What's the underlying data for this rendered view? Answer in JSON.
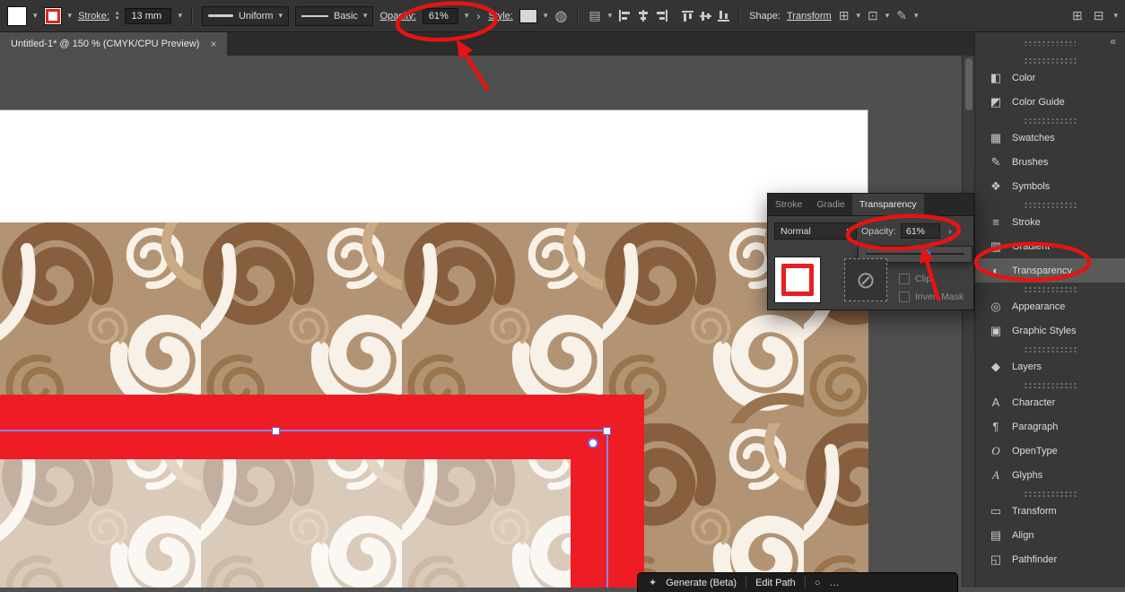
{
  "toolbar": {
    "stroke_label": "Stroke:",
    "stroke_value": "13 mm",
    "width_profile": "Uniform",
    "brush_name": "Basic",
    "opacity_label": "Opacity:",
    "opacity_value": "61%",
    "style_label": "Style:",
    "shape_label": "Shape:",
    "transform_label": "Transform"
  },
  "tabbar": {
    "document_title": "Untitled-1* @ 150 % (CMYK/CPU Preview)",
    "close_glyph": "×"
  },
  "panel": {
    "tabs": [
      {
        "label": "Stroke",
        "name": "stroke"
      },
      {
        "label": "Gradie",
        "name": "gradient"
      },
      {
        "label": "Transparency",
        "name": "transparency",
        "active": true
      }
    ],
    "overflow_glyph": "»",
    "menu_glyph": "≡",
    "blend_mode": "Normal",
    "opacity_label": "Opacity:",
    "opacity_value": "61%",
    "mask_glyph": "⊘",
    "clip_label": "Clip",
    "invert_label": "Invert Mask"
  },
  "sidebar": {
    "collapse_glyph": "«",
    "items": [
      {
        "label": "Color",
        "icon": "◧",
        "name": "color",
        "group_start": true
      },
      {
        "label": "Color Guide",
        "icon": "◩",
        "name": "color-guide"
      },
      {
        "label": "Swatches",
        "icon": "▦",
        "name": "swatches",
        "group_start": true
      },
      {
        "label": "Brushes",
        "icon": "✎",
        "name": "brushes"
      },
      {
        "label": "Symbols",
        "icon": "❖",
        "name": "symbols"
      },
      {
        "label": "Stroke",
        "icon": "≡",
        "name": "stroke",
        "group_start": true
      },
      {
        "label": "Gradient",
        "icon": "▥",
        "name": "gradient"
      },
      {
        "label": "Transparency",
        "icon": "◐",
        "name": "transparency",
        "active": true
      },
      {
        "label": "Appearance",
        "icon": "◎",
        "name": "appearance",
        "group_start": true
      },
      {
        "label": "Graphic Styles",
        "icon": "▣",
        "name": "graphic-styles"
      },
      {
        "label": "Layers",
        "icon": "◆",
        "name": "layers",
        "group_start": true
      },
      {
        "label": "Character",
        "icon": "A",
        "name": "character",
        "group_start": true
      },
      {
        "label": "Paragraph",
        "icon": "¶",
        "name": "paragraph"
      },
      {
        "label": "OpenType",
        "icon": "O",
        "name": "opentype",
        "serif": true
      },
      {
        "label": "Glyphs",
        "icon": "A",
        "name": "glyphs",
        "serif": true
      },
      {
        "label": "Transform",
        "icon": "▭",
        "name": "transform",
        "group_start": true
      },
      {
        "label": "Align",
        "icon": "▤",
        "name": "align"
      },
      {
        "label": "Pathfinder",
        "icon": "◱",
        "name": "pathfinder"
      }
    ]
  },
  "bottombar": {
    "sparkle_glyph": "✦",
    "generate_label": "Generate (Beta)",
    "edit_path_label": "Edit Path",
    "person_glyph": "○",
    "more_glyph": "…"
  },
  "colors": {
    "annotation_red": "#e51414",
    "artwork_red": "#ee1d25",
    "selection_purple": "#837af2",
    "slider_blue": "#2f8ce8",
    "pattern_dark_brown": "#875f3f",
    "pattern_mid_brown": "#99744e",
    "pattern_light_brown": "#caa985",
    "pattern_background": "#b29474",
    "pattern_cream": "#f7f1e8"
  }
}
